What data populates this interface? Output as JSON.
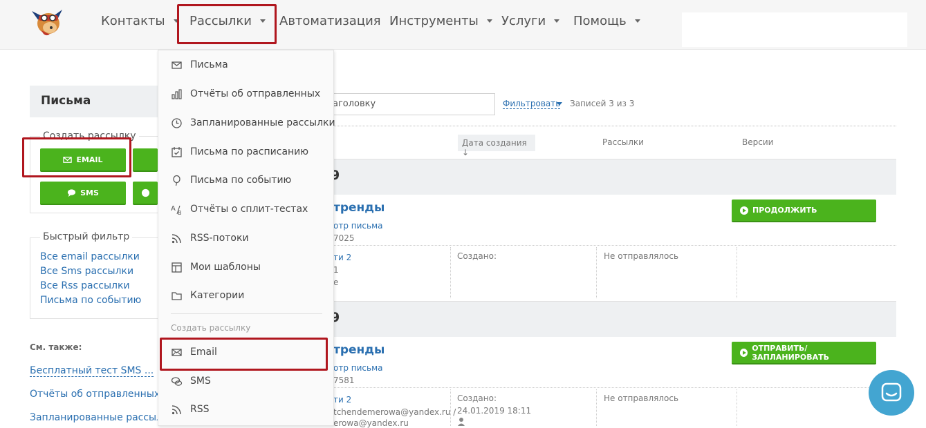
{
  "nav": {
    "items": [
      {
        "label": "Контакты",
        "caret": true
      },
      {
        "label": "Рассылки",
        "caret": true
      },
      {
        "label": "Автоматизация",
        "caret": false
      },
      {
        "label": "Инструменты",
        "caret": true
      },
      {
        "label": "Услуги",
        "caret": true
      },
      {
        "label": "Помощь",
        "caret": true
      }
    ],
    "highlight_color": "#b0161e"
  },
  "dropdown": {
    "items": [
      {
        "label": "Письма",
        "icon": "envelope-icon"
      },
      {
        "label": "Отчёты об отправленных",
        "icon": "bar-chart-icon"
      },
      {
        "label": "Запланированные рассылки",
        "icon": "clock-icon"
      },
      {
        "label": "Письма по расписанию",
        "icon": "calendar-check-icon"
      },
      {
        "label": "Письма по событию",
        "icon": "balloon-icon"
      },
      {
        "label": "Отчёты о сплит-тестах",
        "icon": "split-test-icon"
      },
      {
        "label": "RSS-потоки",
        "icon": "rss-icon"
      },
      {
        "label": "Мои шаблоны",
        "icon": "template-icon"
      },
      {
        "label": "Категории",
        "icon": "folder-icon"
      }
    ],
    "section_label": "Создать рассылку",
    "create_items": [
      {
        "label": "Email",
        "icon": "envelope-icon"
      },
      {
        "label": "SMS",
        "icon": "chat-bubbles-icon"
      },
      {
        "label": "RSS",
        "icon": "rss-icon"
      }
    ]
  },
  "sidebar": {
    "title": "Письма",
    "create_legend": "Создать рассылку",
    "buttons": {
      "email": "EMAIL",
      "sms": "SMS"
    },
    "quick_filter_legend": "Быстрый фильтр",
    "quick_filters": [
      "Все email рассылки",
      "Все Sms рассылки",
      "Все Rss рассылки",
      "Письма по событию"
    ],
    "see_also_label": "См. также:",
    "see_also": [
      "Бесплатный тест SMS ...",
      "Отчёты об отправленных",
      "Запланированные рассылки"
    ]
  },
  "main": {
    "search_value": "аголовку",
    "filter_label": "Фильтровать",
    "count_label": "Записей 3 из 3",
    "columns": {
      "created": "Дата создания ↓",
      "mailings": "Рассылки",
      "versions": "Версии"
    },
    "groups": [
      "9",
      "9"
    ],
    "messages": [
      {
        "title": "тренды",
        "preview": "отр письма",
        "id": "7025",
        "detail_link": "ти 2",
        "detail_line1": "1",
        "detail_line2": "е",
        "created_label": "Создано:",
        "created_value": "",
        "status": "Не отправлялось",
        "action": "ПРОДОЛЖИТЬ"
      },
      {
        "title": "тренды",
        "preview": "отр письма",
        "id": "7581",
        "detail_link": "ти 2",
        "detail_line1": "tchendemerowa@yandex.ru /",
        "detail_line2": "erowa@yandex.ru",
        "created_label": "Создано:",
        "created_value": "24.01.2019 18:11",
        "status": "Не отправлялось",
        "action": "ОТПРАВИТЬ/ЗАПЛАНИРОВАТЬ"
      }
    ]
  }
}
